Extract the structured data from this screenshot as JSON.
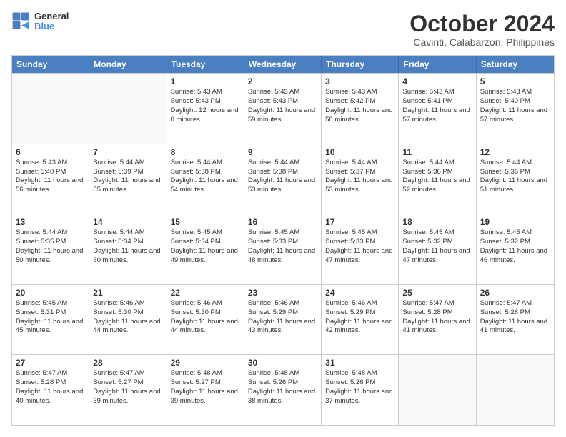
{
  "logo": {
    "line1": "General",
    "line2": "Blue"
  },
  "title": "October 2024",
  "subtitle": "Cavinti, Calabarzon, Philippines",
  "days": [
    "Sunday",
    "Monday",
    "Tuesday",
    "Wednesday",
    "Thursday",
    "Friday",
    "Saturday"
  ],
  "weeks": [
    [
      {
        "day": "",
        "sunrise": "",
        "sunset": "",
        "daylight": ""
      },
      {
        "day": "",
        "sunrise": "",
        "sunset": "",
        "daylight": ""
      },
      {
        "day": "1",
        "sunrise": "Sunrise: 5:43 AM",
        "sunset": "Sunset: 5:43 PM",
        "daylight": "Daylight: 12 hours and 0 minutes."
      },
      {
        "day": "2",
        "sunrise": "Sunrise: 5:43 AM",
        "sunset": "Sunset: 5:43 PM",
        "daylight": "Daylight: 11 hours and 59 minutes."
      },
      {
        "day": "3",
        "sunrise": "Sunrise: 5:43 AM",
        "sunset": "Sunset: 5:42 PM",
        "daylight": "Daylight: 11 hours and 58 minutes."
      },
      {
        "day": "4",
        "sunrise": "Sunrise: 5:43 AM",
        "sunset": "Sunset: 5:41 PM",
        "daylight": "Daylight: 11 hours and 57 minutes."
      },
      {
        "day": "5",
        "sunrise": "Sunrise: 5:43 AM",
        "sunset": "Sunset: 5:40 PM",
        "daylight": "Daylight: 11 hours and 57 minutes."
      }
    ],
    [
      {
        "day": "6",
        "sunrise": "Sunrise: 5:43 AM",
        "sunset": "Sunset: 5:40 PM",
        "daylight": "Daylight: 11 hours and 56 minutes."
      },
      {
        "day": "7",
        "sunrise": "Sunrise: 5:44 AM",
        "sunset": "Sunset: 5:39 PM",
        "daylight": "Daylight: 11 hours and 55 minutes."
      },
      {
        "day": "8",
        "sunrise": "Sunrise: 5:44 AM",
        "sunset": "Sunset: 5:38 PM",
        "daylight": "Daylight: 11 hours and 54 minutes."
      },
      {
        "day": "9",
        "sunrise": "Sunrise: 5:44 AM",
        "sunset": "Sunset: 5:38 PM",
        "daylight": "Daylight: 11 hours and 53 minutes."
      },
      {
        "day": "10",
        "sunrise": "Sunrise: 5:44 AM",
        "sunset": "Sunset: 5:37 PM",
        "daylight": "Daylight: 11 hours and 53 minutes."
      },
      {
        "day": "11",
        "sunrise": "Sunrise: 5:44 AM",
        "sunset": "Sunset: 5:36 PM",
        "daylight": "Daylight: 11 hours and 52 minutes."
      },
      {
        "day": "12",
        "sunrise": "Sunrise: 5:44 AM",
        "sunset": "Sunset: 5:36 PM",
        "daylight": "Daylight: 11 hours and 51 minutes."
      }
    ],
    [
      {
        "day": "13",
        "sunrise": "Sunrise: 5:44 AM",
        "sunset": "Sunset: 5:35 PM",
        "daylight": "Daylight: 11 hours and 50 minutes."
      },
      {
        "day": "14",
        "sunrise": "Sunrise: 5:44 AM",
        "sunset": "Sunset: 5:34 PM",
        "daylight": "Daylight: 11 hours and 50 minutes."
      },
      {
        "day": "15",
        "sunrise": "Sunrise: 5:45 AM",
        "sunset": "Sunset: 5:34 PM",
        "daylight": "Daylight: 11 hours and 49 minutes."
      },
      {
        "day": "16",
        "sunrise": "Sunrise: 5:45 AM",
        "sunset": "Sunset: 5:33 PM",
        "daylight": "Daylight: 11 hours and 48 minutes."
      },
      {
        "day": "17",
        "sunrise": "Sunrise: 5:45 AM",
        "sunset": "Sunset: 5:33 PM",
        "daylight": "Daylight: 11 hours and 47 minutes."
      },
      {
        "day": "18",
        "sunrise": "Sunrise: 5:45 AM",
        "sunset": "Sunset: 5:32 PM",
        "daylight": "Daylight: 11 hours and 47 minutes."
      },
      {
        "day": "19",
        "sunrise": "Sunrise: 5:45 AM",
        "sunset": "Sunset: 5:32 PM",
        "daylight": "Daylight: 11 hours and 46 minutes."
      }
    ],
    [
      {
        "day": "20",
        "sunrise": "Sunrise: 5:45 AM",
        "sunset": "Sunset: 5:31 PM",
        "daylight": "Daylight: 11 hours and 45 minutes."
      },
      {
        "day": "21",
        "sunrise": "Sunrise: 5:46 AM",
        "sunset": "Sunset: 5:30 PM",
        "daylight": "Daylight: 11 hours and 44 minutes."
      },
      {
        "day": "22",
        "sunrise": "Sunrise: 5:46 AM",
        "sunset": "Sunset: 5:30 PM",
        "daylight": "Daylight: 11 hours and 44 minutes."
      },
      {
        "day": "23",
        "sunrise": "Sunrise: 5:46 AM",
        "sunset": "Sunset: 5:29 PM",
        "daylight": "Daylight: 11 hours and 43 minutes."
      },
      {
        "day": "24",
        "sunrise": "Sunrise: 5:46 AM",
        "sunset": "Sunset: 5:29 PM",
        "daylight": "Daylight: 11 hours and 42 minutes."
      },
      {
        "day": "25",
        "sunrise": "Sunrise: 5:47 AM",
        "sunset": "Sunset: 5:28 PM",
        "daylight": "Daylight: 11 hours and 41 minutes."
      },
      {
        "day": "26",
        "sunrise": "Sunrise: 5:47 AM",
        "sunset": "Sunset: 5:28 PM",
        "daylight": "Daylight: 11 hours and 41 minutes."
      }
    ],
    [
      {
        "day": "27",
        "sunrise": "Sunrise: 5:47 AM",
        "sunset": "Sunset: 5:28 PM",
        "daylight": "Daylight: 11 hours and 40 minutes."
      },
      {
        "day": "28",
        "sunrise": "Sunrise: 5:47 AM",
        "sunset": "Sunset: 5:27 PM",
        "daylight": "Daylight: 11 hours and 39 minutes."
      },
      {
        "day": "29",
        "sunrise": "Sunrise: 5:48 AM",
        "sunset": "Sunset: 5:27 PM",
        "daylight": "Daylight: 11 hours and 39 minutes."
      },
      {
        "day": "30",
        "sunrise": "Sunrise: 5:48 AM",
        "sunset": "Sunset: 5:26 PM",
        "daylight": "Daylight: 11 hours and 38 minutes."
      },
      {
        "day": "31",
        "sunrise": "Sunrise: 5:48 AM",
        "sunset": "Sunset: 5:26 PM",
        "daylight": "Daylight: 11 hours and 37 minutes."
      },
      {
        "day": "",
        "sunrise": "",
        "sunset": "",
        "daylight": ""
      },
      {
        "day": "",
        "sunrise": "",
        "sunset": "",
        "daylight": ""
      }
    ]
  ]
}
